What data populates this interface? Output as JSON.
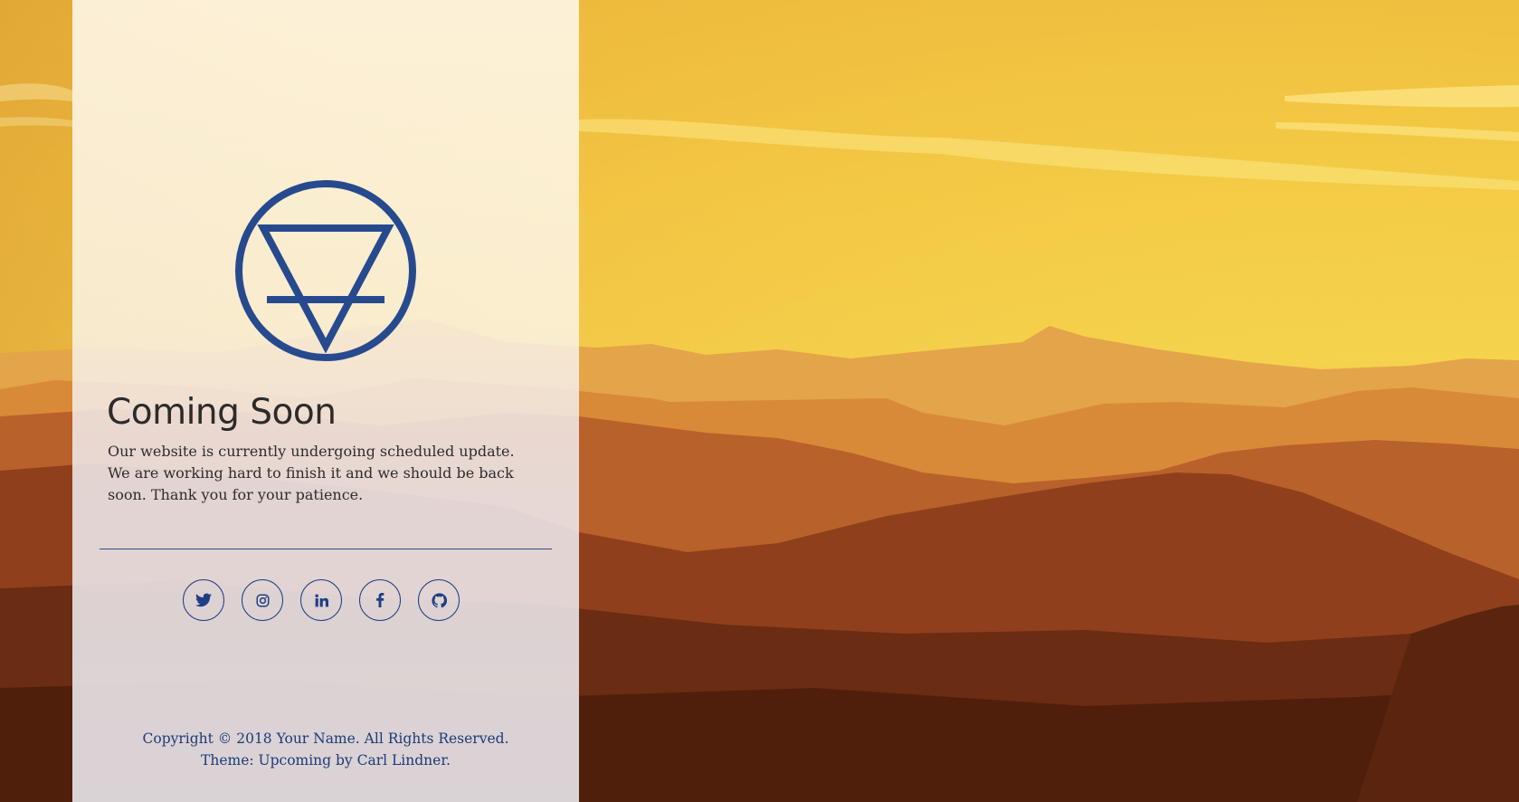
{
  "page": {
    "title": "Coming Soon",
    "message": "Our website is currently undergoing scheduled update. We are working hard to finish it and we should be back soon. Thank you for your patience."
  },
  "logo": {
    "icon": "earth-symbol-icon",
    "color": "#274a8f"
  },
  "social": [
    {
      "name": "twitter",
      "icon": "twitter-icon"
    },
    {
      "name": "instagram",
      "icon": "instagram-icon"
    },
    {
      "name": "linkedin",
      "icon": "linkedin-icon"
    },
    {
      "name": "facebook",
      "icon": "facebook-icon"
    },
    {
      "name": "github",
      "icon": "github-icon"
    }
  ],
  "footer": {
    "copyright": "Copyright © 2018 Your Name. All Rights Reserved.",
    "theme": "Theme: Upcoming by Carl Lindner."
  },
  "colors": {
    "accent": "#274a8f",
    "text": "#2b2b2b",
    "footer_text": "#1e3a78"
  }
}
